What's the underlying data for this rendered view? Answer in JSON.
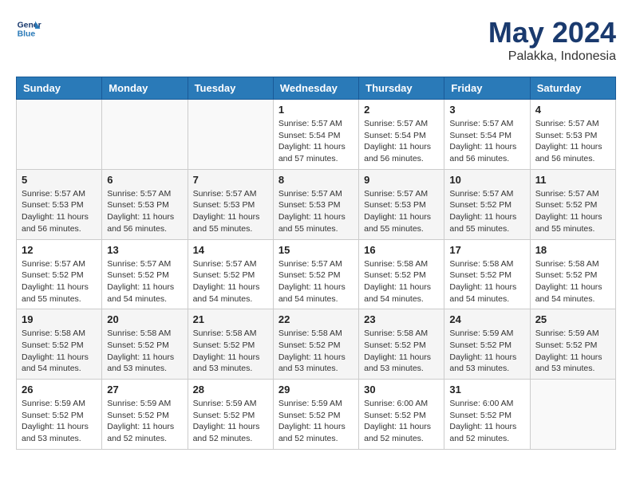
{
  "header": {
    "logo": {
      "line1": "General",
      "line2": "Blue"
    },
    "month": "May 2024",
    "location": "Palakka, Indonesia"
  },
  "days_of_week": [
    "Sunday",
    "Monday",
    "Tuesday",
    "Wednesday",
    "Thursday",
    "Friday",
    "Saturday"
  ],
  "weeks": [
    [
      {
        "day": "",
        "info": ""
      },
      {
        "day": "",
        "info": ""
      },
      {
        "day": "",
        "info": ""
      },
      {
        "day": "1",
        "info": "Sunrise: 5:57 AM\nSunset: 5:54 PM\nDaylight: 11 hours\nand 57 minutes."
      },
      {
        "day": "2",
        "info": "Sunrise: 5:57 AM\nSunset: 5:54 PM\nDaylight: 11 hours\nand 56 minutes."
      },
      {
        "day": "3",
        "info": "Sunrise: 5:57 AM\nSunset: 5:54 PM\nDaylight: 11 hours\nand 56 minutes."
      },
      {
        "day": "4",
        "info": "Sunrise: 5:57 AM\nSunset: 5:53 PM\nDaylight: 11 hours\nand 56 minutes."
      }
    ],
    [
      {
        "day": "5",
        "info": "Sunrise: 5:57 AM\nSunset: 5:53 PM\nDaylight: 11 hours\nand 56 minutes."
      },
      {
        "day": "6",
        "info": "Sunrise: 5:57 AM\nSunset: 5:53 PM\nDaylight: 11 hours\nand 56 minutes."
      },
      {
        "day": "7",
        "info": "Sunrise: 5:57 AM\nSunset: 5:53 PM\nDaylight: 11 hours\nand 55 minutes."
      },
      {
        "day": "8",
        "info": "Sunrise: 5:57 AM\nSunset: 5:53 PM\nDaylight: 11 hours\nand 55 minutes."
      },
      {
        "day": "9",
        "info": "Sunrise: 5:57 AM\nSunset: 5:53 PM\nDaylight: 11 hours\nand 55 minutes."
      },
      {
        "day": "10",
        "info": "Sunrise: 5:57 AM\nSunset: 5:52 PM\nDaylight: 11 hours\nand 55 minutes."
      },
      {
        "day": "11",
        "info": "Sunrise: 5:57 AM\nSunset: 5:52 PM\nDaylight: 11 hours\nand 55 minutes."
      }
    ],
    [
      {
        "day": "12",
        "info": "Sunrise: 5:57 AM\nSunset: 5:52 PM\nDaylight: 11 hours\nand 55 minutes."
      },
      {
        "day": "13",
        "info": "Sunrise: 5:57 AM\nSunset: 5:52 PM\nDaylight: 11 hours\nand 54 minutes."
      },
      {
        "day": "14",
        "info": "Sunrise: 5:57 AM\nSunset: 5:52 PM\nDaylight: 11 hours\nand 54 minutes."
      },
      {
        "day": "15",
        "info": "Sunrise: 5:57 AM\nSunset: 5:52 PM\nDaylight: 11 hours\nand 54 minutes."
      },
      {
        "day": "16",
        "info": "Sunrise: 5:58 AM\nSunset: 5:52 PM\nDaylight: 11 hours\nand 54 minutes."
      },
      {
        "day": "17",
        "info": "Sunrise: 5:58 AM\nSunset: 5:52 PM\nDaylight: 11 hours\nand 54 minutes."
      },
      {
        "day": "18",
        "info": "Sunrise: 5:58 AM\nSunset: 5:52 PM\nDaylight: 11 hours\nand 54 minutes."
      }
    ],
    [
      {
        "day": "19",
        "info": "Sunrise: 5:58 AM\nSunset: 5:52 PM\nDaylight: 11 hours\nand 54 minutes."
      },
      {
        "day": "20",
        "info": "Sunrise: 5:58 AM\nSunset: 5:52 PM\nDaylight: 11 hours\nand 53 minutes."
      },
      {
        "day": "21",
        "info": "Sunrise: 5:58 AM\nSunset: 5:52 PM\nDaylight: 11 hours\nand 53 minutes."
      },
      {
        "day": "22",
        "info": "Sunrise: 5:58 AM\nSunset: 5:52 PM\nDaylight: 11 hours\nand 53 minutes."
      },
      {
        "day": "23",
        "info": "Sunrise: 5:58 AM\nSunset: 5:52 PM\nDaylight: 11 hours\nand 53 minutes."
      },
      {
        "day": "24",
        "info": "Sunrise: 5:59 AM\nSunset: 5:52 PM\nDaylight: 11 hours\nand 53 minutes."
      },
      {
        "day": "25",
        "info": "Sunrise: 5:59 AM\nSunset: 5:52 PM\nDaylight: 11 hours\nand 53 minutes."
      }
    ],
    [
      {
        "day": "26",
        "info": "Sunrise: 5:59 AM\nSunset: 5:52 PM\nDaylight: 11 hours\nand 53 minutes."
      },
      {
        "day": "27",
        "info": "Sunrise: 5:59 AM\nSunset: 5:52 PM\nDaylight: 11 hours\nand 52 minutes."
      },
      {
        "day": "28",
        "info": "Sunrise: 5:59 AM\nSunset: 5:52 PM\nDaylight: 11 hours\nand 52 minutes."
      },
      {
        "day": "29",
        "info": "Sunrise: 5:59 AM\nSunset: 5:52 PM\nDaylight: 11 hours\nand 52 minutes."
      },
      {
        "day": "30",
        "info": "Sunrise: 6:00 AM\nSunset: 5:52 PM\nDaylight: 11 hours\nand 52 minutes."
      },
      {
        "day": "31",
        "info": "Sunrise: 6:00 AM\nSunset: 5:52 PM\nDaylight: 11 hours\nand 52 minutes."
      },
      {
        "day": "",
        "info": ""
      }
    ]
  ]
}
